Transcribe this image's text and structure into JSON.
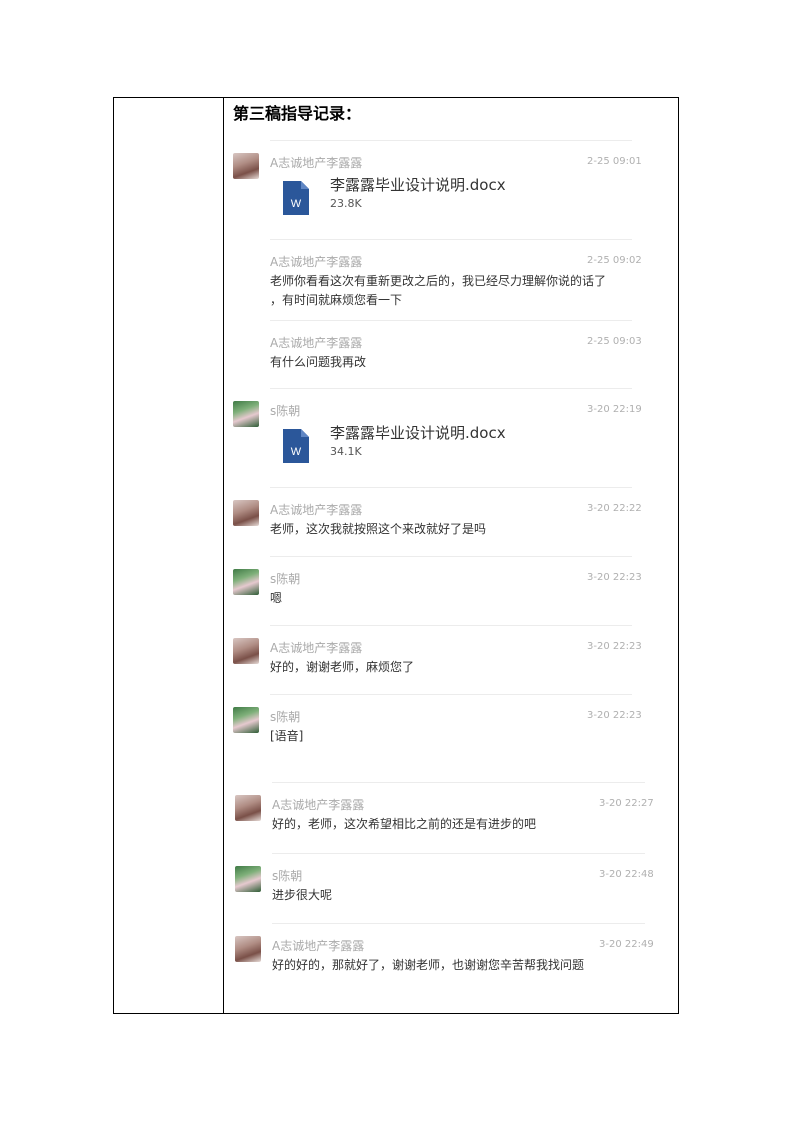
{
  "title": "第三稿指导记录：",
  "messages": [
    {
      "sender": "A志诚地产李露露",
      "time": "2-25 09:01",
      "file": {
        "name": "李露露毕业设计说明.docx",
        "size": "23.8K"
      }
    },
    {
      "sender": "A志诚地产李露露",
      "time": "2-25 09:02",
      "lines": [
        "老师你看看这次有重新更改之后的，我已经尽力理解你说的话了",
        "，有时间就麻烦您看一下"
      ]
    },
    {
      "sender": "A志诚地产李露露",
      "time": "2-25 09:03",
      "lines": [
        "有什么问题我再改"
      ]
    },
    {
      "sender": "s陈朝",
      "time": "3-20 22:19",
      "file": {
        "name": "李露露毕业设计说明.docx",
        "size": "34.1K"
      }
    },
    {
      "sender": "A志诚地产李露露",
      "time": "3-20 22:22",
      "lines": [
        "老师，这次我就按照这个来改就好了是吗"
      ]
    },
    {
      "sender": "s陈朝",
      "time": "3-20 22:23",
      "lines": [
        "嗯"
      ]
    },
    {
      "sender": "A志诚地产李露露",
      "time": "3-20 22:23",
      "lines": [
        "好的，谢谢老师，麻烦您了"
      ]
    },
    {
      "sender": "s陈朝",
      "time": "3-20 22:23",
      "lines": [
        "[语音]"
      ]
    },
    {
      "sender": "A志诚地产李露露",
      "time": "3-20 22:27",
      "lines": [
        "好的，老师，这次希望相比之前的还是有进步的吧"
      ]
    },
    {
      "sender": "s陈朝",
      "time": "3-20 22:48",
      "lines": [
        "进步很大呢"
      ]
    },
    {
      "sender": "A志诚地产李露露",
      "time": "3-20 22:49",
      "lines": [
        "好的好的，那就好了，谢谢老师，也谢谢您辛苦帮我找问题"
      ]
    }
  ],
  "icons": {
    "avatar_female": "avatar-female",
    "avatar_male": "avatar-male",
    "word_file": "word-file-icon",
    "word_letter": "W"
  }
}
